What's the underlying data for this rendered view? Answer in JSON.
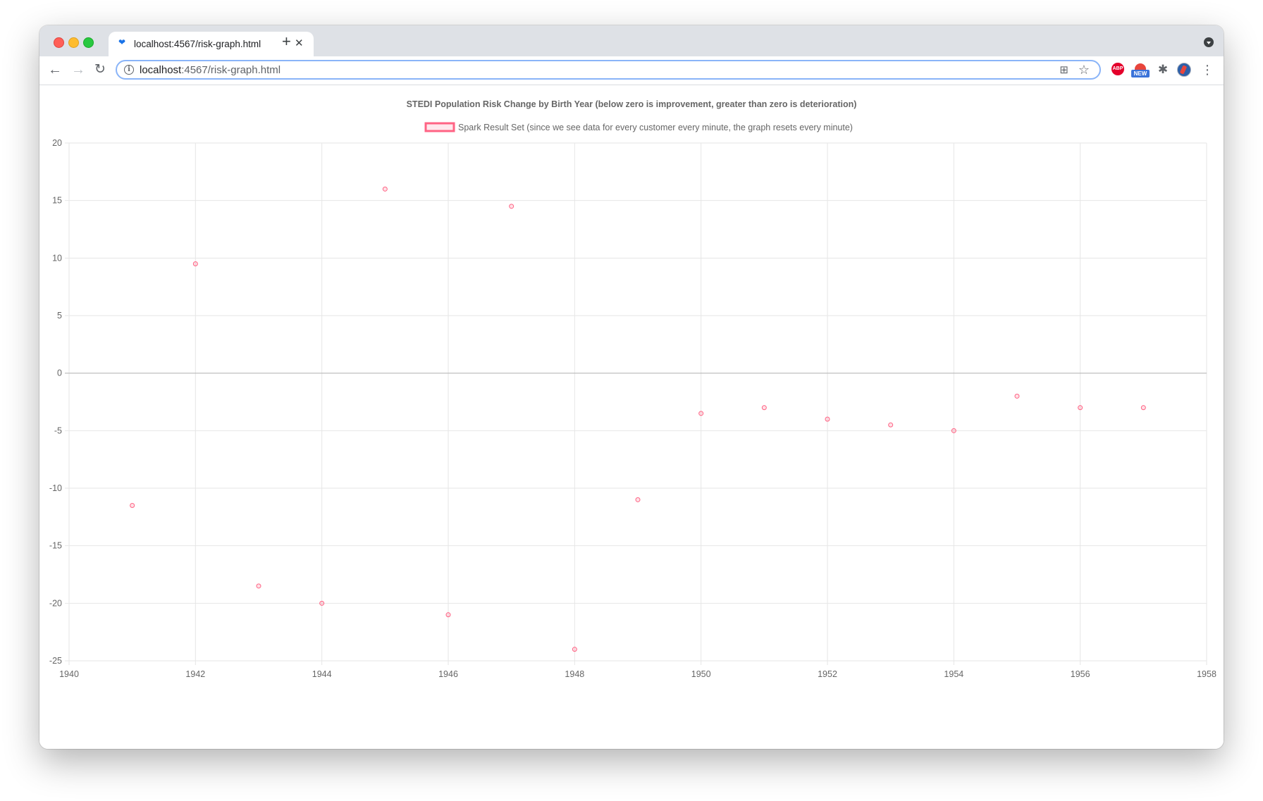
{
  "browser": {
    "tab": {
      "title": "localhost:4567/risk-graph.html",
      "favicon": "heart-icon",
      "close_glyph": "✕"
    },
    "new_tab_glyph": "+",
    "address_bar": {
      "host": "localhost",
      "path": ":4567/risk-graph.html"
    },
    "extensions": {
      "abp_label": "ABP",
      "new_badge": "NEW"
    },
    "icons": {
      "back": "←",
      "forward": "→",
      "reload": "↻",
      "info": "i",
      "qr": "⊞",
      "star": "☆",
      "puzzle": "✱",
      "menu": "⋮"
    }
  },
  "chart_data": {
    "type": "scatter",
    "title": "STEDI Population Risk Change by Birth Year (below zero is improvement, greater than zero is deterioration)",
    "legend": {
      "position": "top",
      "entries": [
        "Spark Result Set (since we see data for every customer every minute, the graph resets every minute)"
      ]
    },
    "series": [
      {
        "name": "Spark Result Set (since we see data for every customer every minute, the graph resets every minute)",
        "color": "#ff6384",
        "points": [
          {
            "x": 1941,
            "y": -11.5
          },
          {
            "x": 1942,
            "y": 9.5
          },
          {
            "x": 1943,
            "y": -18.5
          },
          {
            "x": 1944,
            "y": -20
          },
          {
            "x": 1945,
            "y": 16
          },
          {
            "x": 1946,
            "y": -21
          },
          {
            "x": 1947,
            "y": 14.5
          },
          {
            "x": 1948,
            "y": -24
          },
          {
            "x": 1949,
            "y": -11
          },
          {
            "x": 1950,
            "y": -3.5
          },
          {
            "x": 1951,
            "y": -3
          },
          {
            "x": 1952,
            "y": -4
          },
          {
            "x": 1953,
            "y": -4.5
          },
          {
            "x": 1954,
            "y": -5
          },
          {
            "x": 1955,
            "y": -2
          },
          {
            "x": 1956,
            "y": -3
          },
          {
            "x": 1957,
            "y": -3
          }
        ]
      }
    ],
    "xlim": [
      1940,
      1958
    ],
    "ylim": [
      -25,
      20
    ],
    "x_ticks": [
      1940,
      1942,
      1944,
      1946,
      1948,
      1950,
      1952,
      1954,
      1956,
      1958
    ],
    "y_ticks": [
      20,
      15,
      10,
      5,
      0,
      -5,
      -10,
      -15,
      -20,
      -25
    ],
    "x_grid_step": 2,
    "y_grid_step": 5,
    "grid": true,
    "colors": {
      "grid": "#e6e6e6",
      "zero_line": "#b8b8b8",
      "text": "#666666"
    }
  }
}
